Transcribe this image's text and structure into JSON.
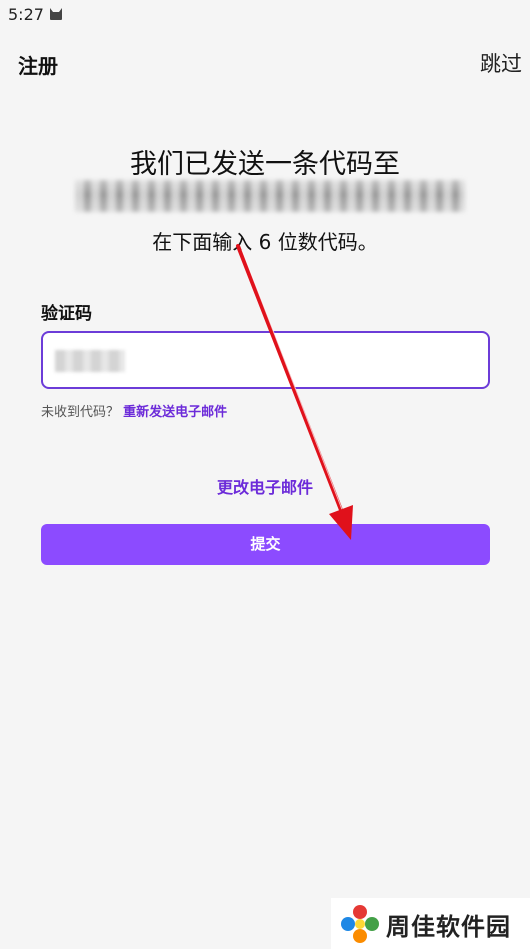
{
  "status_bar": {
    "time": "5:27",
    "notification_icon": "cat-icon"
  },
  "header": {
    "title": "注册",
    "skip_label": "跳过"
  },
  "main": {
    "headline": "我们已发送一条代码至",
    "instruction": "在下面输入 6 位数代码。",
    "code_label": "验证码",
    "resend_prefix": "未收到代码？",
    "resend_link": "重新发送电子邮件",
    "change_email": "更改电子邮件",
    "submit_label": "提交"
  },
  "watermark": {
    "text": "周佳软件园"
  },
  "colors": {
    "accent": "#6c2bd9",
    "input_border": "#6c3cd8",
    "submit_bg": "#8c4bff",
    "annotation_arrow": "#e0111b",
    "background": "#f5f5f5"
  }
}
